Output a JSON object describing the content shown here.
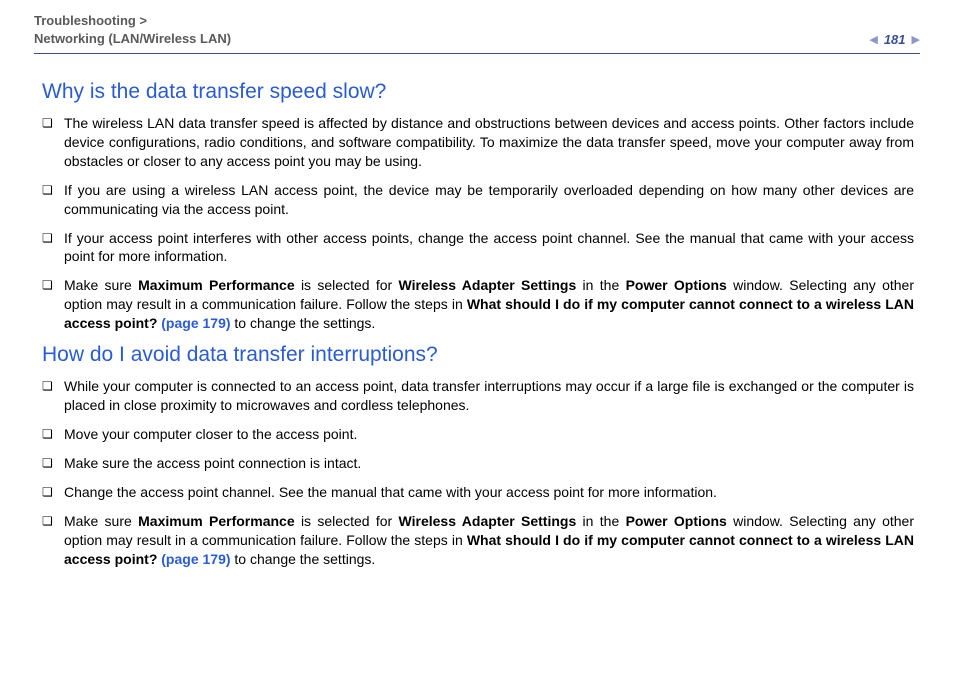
{
  "header": {
    "breadcrumb_line1": "Troubleshooting >",
    "breadcrumb_line2": "Networking (LAN/Wireless LAN)",
    "page_number": "181"
  },
  "sections": [
    {
      "heading": "Why is the data transfer speed slow?",
      "items": [
        {
          "runs": [
            {
              "t": "The wireless LAN data transfer speed is affected by distance and obstructions between devices and access points. Other factors include device configurations, radio conditions, and software compatibility. To maximize the data transfer speed, move your computer away from obstacles or closer to any access point you may be using."
            }
          ]
        },
        {
          "runs": [
            {
              "t": "If you are using a wireless LAN access point, the device may be temporarily overloaded depending on how many other devices are communicating via the access point."
            }
          ]
        },
        {
          "runs": [
            {
              "t": "If your access point interferes with other access points, change the access point channel. See the manual that came with your access point for more information."
            }
          ]
        },
        {
          "runs": [
            {
              "t": "Make sure "
            },
            {
              "t": "Maximum Performance",
              "style": "b"
            },
            {
              "t": " is selected for "
            },
            {
              "t": "Wireless Adapter Settings",
              "style": "b"
            },
            {
              "t": " in the "
            },
            {
              "t": "Power Options",
              "style": "b"
            },
            {
              "t": " window. Selecting any other option may result in a communication failure. Follow the steps in "
            },
            {
              "t": "What should I do if my computer cannot connect to a wireless LAN access point? ",
              "style": "b"
            },
            {
              "t": "(page 179)",
              "style": "link"
            },
            {
              "t": " to change the settings."
            }
          ]
        }
      ]
    },
    {
      "heading": "How do I avoid data transfer interruptions?",
      "items": [
        {
          "runs": [
            {
              "t": "While your computer is connected to an access point, data transfer interruptions may occur if a large file is exchanged or the computer is placed in close proximity to microwaves and cordless telephones."
            }
          ]
        },
        {
          "runs": [
            {
              "t": "Move your computer closer to the access point."
            }
          ]
        },
        {
          "runs": [
            {
              "t": "Make sure the access point connection is intact."
            }
          ]
        },
        {
          "runs": [
            {
              "t": "Change the access point channel. See the manual that came with your access point for more information."
            }
          ]
        },
        {
          "runs": [
            {
              "t": "Make sure "
            },
            {
              "t": "Maximum Performance",
              "style": "b"
            },
            {
              "t": " is selected for "
            },
            {
              "t": "Wireless Adapter Settings",
              "style": "b"
            },
            {
              "t": " in the "
            },
            {
              "t": "Power Options",
              "style": "b"
            },
            {
              "t": " window. Selecting any other option may result in a communication failure. Follow the steps in "
            },
            {
              "t": "What should I do if my computer cannot connect to a wireless LAN access point? ",
              "style": "b"
            },
            {
              "t": "(page 179)",
              "style": "link"
            },
            {
              "t": " to change the settings."
            }
          ]
        }
      ]
    }
  ]
}
